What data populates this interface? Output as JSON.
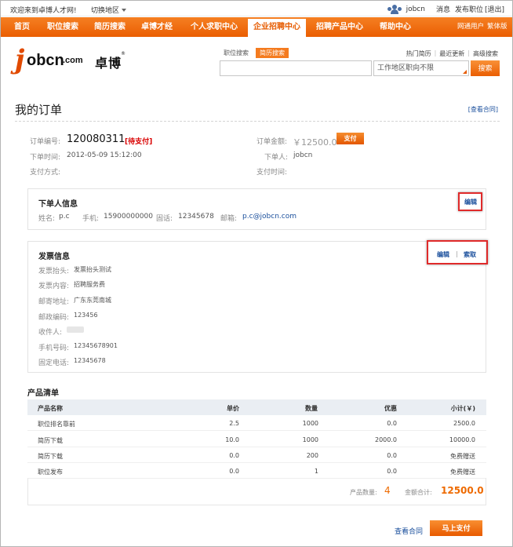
{
  "topbar": {
    "welcome": "欢迎来到卓博人才网!",
    "region": "切换地区",
    "username": "jobcn",
    "links": [
      "消息",
      "发布职位",
      "[退出]"
    ]
  },
  "nav": {
    "items": [
      "首页",
      "职位搜索",
      "简历搜索",
      "卓博才经",
      "个人求职中心",
      "企业招聘中心",
      "招聘产品中心",
      "帮助中心"
    ],
    "active": "企业招聘中心",
    "sub": [
      "网通用户",
      "繁体版"
    ]
  },
  "logo": {
    "j": "j",
    "obcn": "obcn",
    "com": ".com",
    "cn": "卓博",
    "reg": "®"
  },
  "search": {
    "tabs": [
      "职位搜索",
      "简历搜索"
    ],
    "active_tab": "简历搜索",
    "hot_links": [
      "热门简历",
      "最近更新",
      "高级搜索"
    ],
    "area_placeholder": "工作地区职向不限",
    "button": "搜索"
  },
  "page": {
    "title": "我的订单",
    "view_contract": "[查看合同]"
  },
  "order": {
    "no_label": "订单编号:",
    "no": "120080311",
    "status": "[待支付]",
    "time_label": "下单时间:",
    "time": "2012-05-09 15:12:00",
    "pay_method_label": "支付方式:",
    "amount_label": "订单金额:",
    "amount": "￥12500.0",
    "pay_button": "支付",
    "user_label": "下单人:",
    "user": "jobcn",
    "pay_time_label": "支付时间:"
  },
  "buyer": {
    "title": "下单人信息",
    "edit": "编辑",
    "name_label": "姓名:",
    "name": "p.c",
    "mobile_label": "手机:",
    "mobile": "15900000000",
    "phone_label": "固话:",
    "phone": "12345678",
    "email_label": "邮箱:",
    "email": "p.c@jobcn.com"
  },
  "invoice": {
    "title": "发票信息",
    "edit": "编辑",
    "sep": "|",
    "request": "索取",
    "rows": [
      {
        "label": "发票抬头:",
        "value": "发票抬头测试"
      },
      {
        "label": "发票内容:",
        "value": "招聘服务费"
      },
      {
        "label": "邮寄地址:",
        "value": "广东东莞南城"
      },
      {
        "label": "邮政编码:",
        "value": "123456"
      },
      {
        "label": "收件人:",
        "value": ""
      },
      {
        "label": "手机号码:",
        "value": "12345678901"
      },
      {
        "label": "固定电话:",
        "value": "12345678"
      }
    ]
  },
  "products": {
    "title": "产品清单",
    "headers": [
      "产品名称",
      "单价",
      "数量",
      "优惠",
      "小计(￥)"
    ],
    "rows": [
      [
        "职位排名靠前",
        "2.5",
        "1000",
        "0.0",
        "2500.0"
      ],
      [
        "简历下载",
        "10.0",
        "1000",
        "2000.0",
        "10000.0"
      ],
      [
        "简历下载",
        "0.0",
        "200",
        "0.0",
        "免费赠送"
      ],
      [
        "职位发布",
        "0.0",
        "1",
        "0.0",
        "免费赠送"
      ]
    ],
    "count_label": "产品数量:",
    "count": "4",
    "total_label": "金额合计:",
    "total": "12500.0"
  },
  "footer": {
    "view_contract": "查看合同",
    "pay_now": "马上支付"
  },
  "colors": {
    "brand": "#f26c0d",
    "link": "#1a4f9c",
    "alert": "#d90000"
  }
}
